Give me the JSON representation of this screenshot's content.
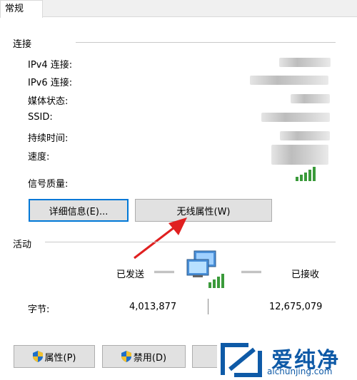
{
  "tab": {
    "label": "常规"
  },
  "connection": {
    "section_label": "连接",
    "rows": [
      {
        "label": "IPv4 连接:"
      },
      {
        "label": "IPv6 连接:"
      },
      {
        "label": "媒体状态:"
      },
      {
        "label": "SSID:"
      },
      {
        "label": "持续时间:"
      },
      {
        "label": "速度:"
      }
    ],
    "signal_label": "信号质量:"
  },
  "buttons": {
    "details": "详细信息(E)...",
    "wireless_props": "无线属性(W)"
  },
  "activity": {
    "section_label": "活动",
    "sent_label": "已发送",
    "received_label": "已接收",
    "bytes_label": "字节:",
    "sent_bytes": "4,013,877",
    "received_bytes": "12,675,079"
  },
  "bottom": {
    "properties": "属性(P)",
    "disable": "禁用(D)"
  },
  "watermark": {
    "name": "爱纯净",
    "url": "aichunjing.com"
  },
  "colors": {
    "arrow": "#e02020",
    "accent": "#0078d7",
    "signal": "#3a9a3a"
  }
}
